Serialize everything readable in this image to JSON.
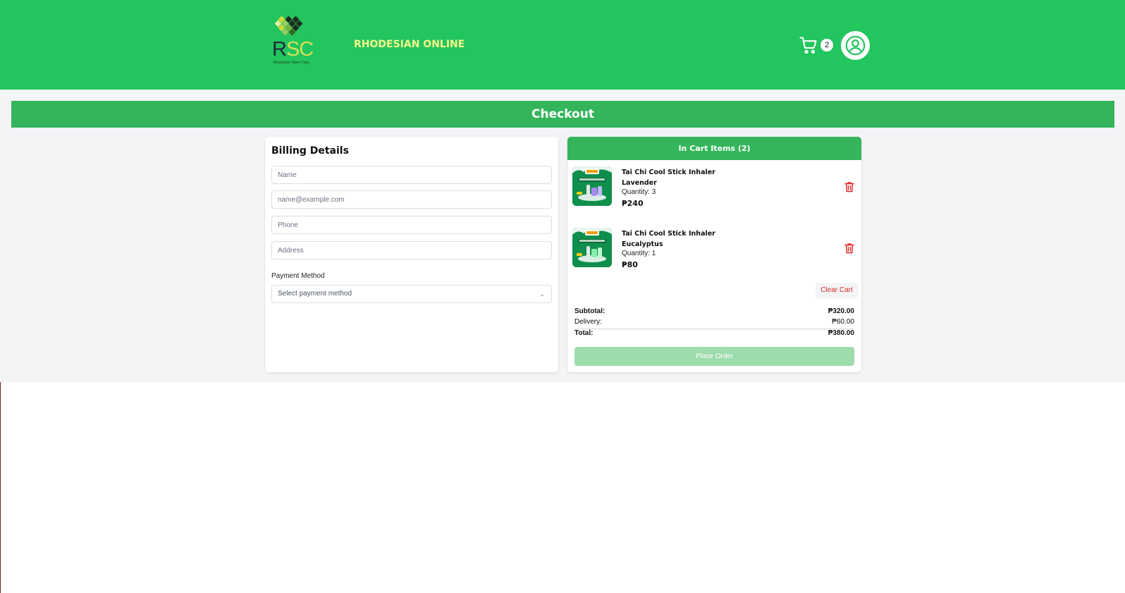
{
  "header": {
    "logo_text": "RSC",
    "logo_tagline": "Rhodesian Sales Corp.",
    "brand": "RHODESIAN ONLINE",
    "cart_count": "2",
    "icons": {
      "cart": "cart-icon",
      "account": "user-circle-icon"
    },
    "colors": {
      "header_bg": "#22c55e",
      "brand_text": "#f5f78a"
    }
  },
  "page": {
    "title": "Checkout",
    "accent": "#34b55b"
  },
  "billing": {
    "title": "Billing Details",
    "name_placeholder": "Name",
    "email_placeholder": "name@example.com",
    "phone_placeholder": "Phone",
    "address_placeholder": "Address",
    "payment_label": "Payment Method",
    "payment_selected": "Select payment method"
  },
  "cart": {
    "header": "In Cart Items (2)",
    "items": [
      {
        "name_line1": "Tai Chi Cool Stick Inhaler",
        "name_line2": "Lavender",
        "quantity": "Quantity: 3",
        "price": "₱240"
      },
      {
        "name_line1": "Tai Chi Cool Stick Inhaler",
        "name_line2": "Eucalyptus",
        "quantity": "Quantity: 1",
        "price": "₱80"
      }
    ],
    "clear_label": "Clear Cart",
    "subtotal_label": "Subtotal:",
    "subtotal_value": "₱320.00",
    "delivery_label": "Delivery:",
    "delivery_value": "₱60.00",
    "total_label": "Total:",
    "total_value": "₱380.00",
    "place_order_label": "Place Order",
    "colors": {
      "delete": "#dc2626",
      "place_order_disabled": "#9ddcad"
    }
  }
}
